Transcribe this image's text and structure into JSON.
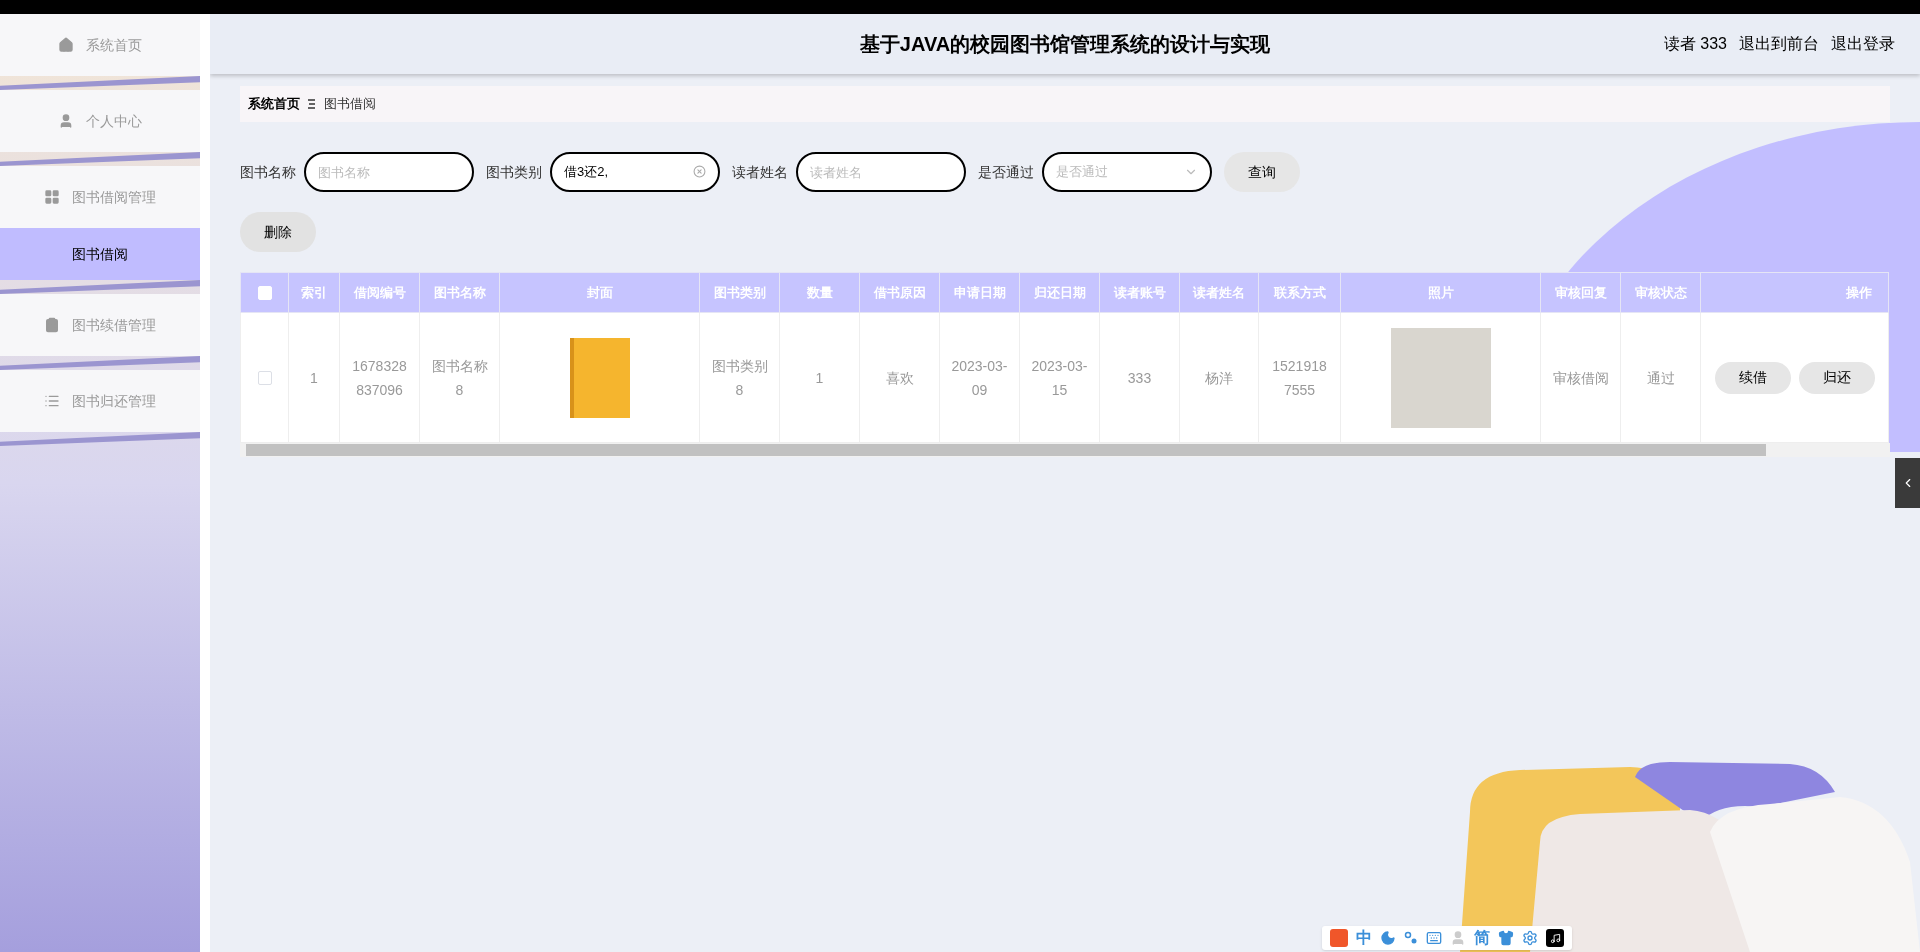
{
  "header": {
    "title": "基于JAVA的校园图书馆管理系统的设计与实现",
    "user": "读者 333",
    "links": [
      "退出到前台",
      "退出登录"
    ]
  },
  "sidebar": {
    "items": [
      {
        "kind": "home",
        "label": "系统首页",
        "selected": false
      },
      {
        "kind": "user",
        "label": "个人中心",
        "selected": false
      },
      {
        "kind": "grid",
        "label": "图书借阅管理",
        "selected": false,
        "children": [
          {
            "label": "图书借阅",
            "selected": true
          }
        ]
      },
      {
        "kind": "clipboard",
        "label": "图书续借管理",
        "selected": false
      },
      {
        "kind": "list",
        "label": "图书归还管理",
        "selected": false
      }
    ]
  },
  "breadcrumb": [
    "系统首页",
    "图书借阅"
  ],
  "filters": [
    {
      "kind": "input",
      "label": "图书名称",
      "placeholder": "图书名称"
    },
    {
      "kind": "input",
      "label": "图书类别",
      "value": "借3还2,",
      "clearable": true
    },
    {
      "kind": "input",
      "label": "读者姓名",
      "placeholder": "读者姓名"
    },
    {
      "kind": "select",
      "label": "是否通过",
      "placeholder": "是否通过"
    }
  ],
  "search_button": "查询",
  "delete_button": "删除",
  "table": {
    "columns": [
      {
        "kind": "checkbox",
        "checked": false
      },
      {
        "kind": "text",
        "label": "索引"
      },
      {
        "kind": "text",
        "label": "借阅编号"
      },
      {
        "kind": "text",
        "label": "图书名称"
      },
      {
        "kind": "image",
        "label": "封面"
      },
      {
        "kind": "text",
        "label": "图书类别"
      },
      {
        "kind": "text",
        "label": "数量"
      },
      {
        "kind": "text",
        "label": "借书原因"
      },
      {
        "kind": "text",
        "label": "申请日期"
      },
      {
        "kind": "text",
        "label": "归还日期"
      },
      {
        "kind": "text",
        "label": "读者账号"
      },
      {
        "kind": "text",
        "label": "读者姓名"
      },
      {
        "kind": "text",
        "label": "联系方式"
      },
      {
        "kind": "image",
        "label": "照片"
      },
      {
        "kind": "text",
        "label": "审核回复"
      },
      {
        "kind": "text",
        "label": "审核状态"
      },
      {
        "kind": "actions",
        "label": "操作"
      }
    ],
    "rows": [
      {
        "cells": [
          {
            "kind": "checkbox",
            "checked": false
          },
          {
            "kind": "text",
            "text": "1"
          },
          {
            "kind": "text",
            "text": "1678328837096"
          },
          {
            "kind": "text",
            "text": "图书名称8"
          },
          {
            "kind": "cover"
          },
          {
            "kind": "text",
            "text": "图书类别8"
          },
          {
            "kind": "text",
            "text": "1"
          },
          {
            "kind": "text",
            "text": "喜欢"
          },
          {
            "kind": "text",
            "text": "2023-03-09"
          },
          {
            "kind": "text",
            "text": "2023-03-15"
          },
          {
            "kind": "text",
            "text": "333"
          },
          {
            "kind": "text",
            "text": "杨洋"
          },
          {
            "kind": "text",
            "text": "15219187555"
          },
          {
            "kind": "photo"
          },
          {
            "kind": "text",
            "text": "审核借阅"
          },
          {
            "kind": "text",
            "text": "通过"
          },
          {
            "kind": "actions",
            "buttons": [
              "续借",
              "归还"
            ]
          }
        ]
      }
    ]
  },
  "ime_toolbar": [
    {
      "kind": "logo"
    },
    {
      "kind": "text",
      "text": "中"
    },
    {
      "kind": "moon"
    },
    {
      "kind": "punct"
    },
    {
      "kind": "keyboard"
    },
    {
      "kind": "person"
    },
    {
      "kind": "text",
      "text": "简"
    },
    {
      "kind": "shirt"
    },
    {
      "kind": "gear"
    },
    {
      "kind": "note"
    }
  ]
}
